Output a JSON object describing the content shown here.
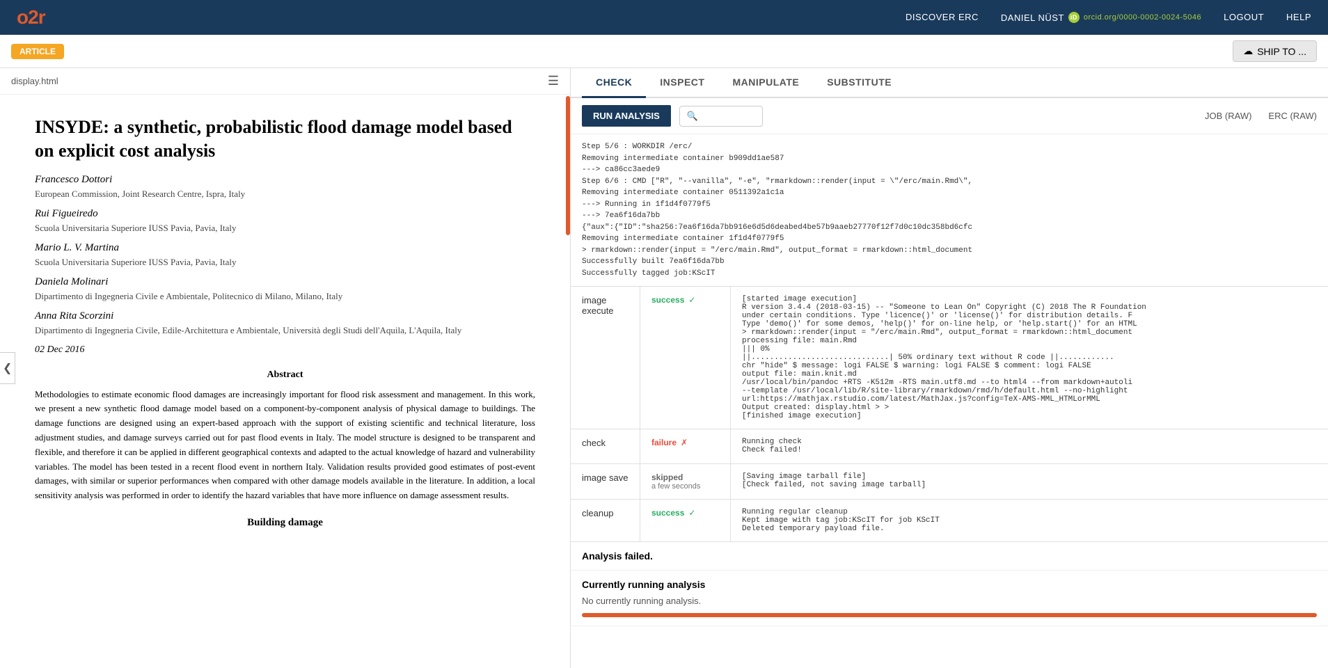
{
  "topnav": {
    "logo_text": "o2r",
    "discover_label": "DISCOVER ERC",
    "user_name": "DANIEL NÜST",
    "orcid_link": "orcid.org/0000-0002-0024-5046",
    "logout_label": "LOGOUT",
    "help_label": "HELP"
  },
  "article_bar": {
    "badge_label": "ARTICLE",
    "ship_to_label": "SHIP TO ..."
  },
  "left_panel": {
    "filename": "display.html",
    "article": {
      "title": "INSYDE: a synthetic, probabilistic flood damage model based on explicit cost analysis",
      "authors": [
        {
          "name": "Francesco Dottori",
          "affiliation": "European Commission, Joint Research Centre, Ispra, Italy"
        },
        {
          "name": "Rui Figueiredo",
          "affiliation": "Scuola Universitaria Superiore IUSS Pavia, Pavia, Italy"
        },
        {
          "name": "Mario L. V. Martina",
          "affiliation": "Scuola Universitaria Superiore IUSS Pavia, Pavia, Italy"
        },
        {
          "name": "Daniela Molinari",
          "affiliation": "Dipartimento di Ingegneria Civile e Ambientale, Politecnico di Milano, Milano, Italy"
        },
        {
          "name": "Anna Rita Scorzini",
          "affiliation": "Dipartimento di Ingegneria Civile, Edile-Architettura e Ambientale, Università degli Studi dell'Aquila, L'Aquila, Italy"
        }
      ],
      "date": "02 Dec 2016",
      "abstract_heading": "Abstract",
      "abstract_text": "Methodologies to estimate economic flood damages are increasingly important for flood risk assessment and management. In this work, we present a new synthetic flood damage model based on a component-by-component analysis of physical damage to buildings. The damage functions are designed using an expert-based approach with the support of existing scientific and technical literature, loss adjustment studies, and damage surveys carried out for past flood events in Italy. The model structure is designed to be transparent and flexible, and therefore it can be applied in different geographical contexts and adapted to the actual knowledge of hazard and vulnerability variables. The model has been tested in a recent flood event in northern Italy. Validation results provided good estimates of post-event damages, with similar or superior performances when compared with other damage models available in the literature. In addition, a local sensitivity analysis was performed in order to identify the hazard variables that have more influence on damage assessment results.",
      "section_heading": "Building damage"
    }
  },
  "right_panel": {
    "tabs": [
      "CHECK",
      "INSPECT",
      "MANIPULATE",
      "SUBSTITUTE"
    ],
    "active_tab": "CHECK",
    "toolbar": {
      "run_analysis_label": "RUN ANALYSIS",
      "search_placeholder": "🔍",
      "job_raw_label": "JOB (RAW)",
      "erc_raw_label": "ERC (RAW)"
    },
    "step_log": {
      "content": "Step 5/6 : WORKDIR /erc/\nRemoving intermediate container b909dd1ae587\n---> ca86cc3aede9\nStep 6/6 : CMD [\"R\", \"--vanilla\", \"-e\", \"rmarkdown::render(input = \\\"/erc/main.Rmd\\\",\nRemoving intermediate container 0511392a1c1a\n---> Running in 1f1d4f0779f5\n---> 7ea6f16da7bb\n{\"aux\":{\"ID\":\"sha256:7ea6f16da7bb916e6d5d6deabed4be57b9aaeb27770f12f7d0c10dc358bd6cfc\nRemoving intermediate container 1f1d4f0779f5\n> rmarkdown::render(input = \"/erc/main.Rmd\", output_format = rmarkdown::html_document\nSuccessfully built 7ea6f16da7bb\nSuccessfully tagged job:KScIT"
    },
    "results": [
      {
        "label": "image execute",
        "status": "success",
        "status_icon": "✓",
        "log": "[started image execution]\nR version 3.4.4 (2018-03-15) -- \"Someone to Lean On\" Copyright (C) 2018 The R Foundation\nunder certain conditions. Type 'licence()' or 'license()' for distribution details. F\nType 'demo()' for some demos, 'help()' for on-line help, or 'help.start()' for an HTML\n> rmarkdown::render(input = \"/erc/main.Rmd\", output_format = rmarkdown::html_document\nprocessing file: main.Rmd\n||| 0%\n||..............................| 50% ordinary text without R code ||............\nchr \"hide\" $ message: logi FALSE $ warning: logi FALSE $ comment: logi FALSE\noutput file: main.knit.md\n/usr/local/bin/pandoc +RTS -K512m -RTS main.utf8.md --to html4 --from markdown+autoli\n--template /usr/local/lib/R/site-library/rmarkdown/rmd/h/default.html --no-highlight\nurl:https://mathjax.rstudio.com/latest/MathJax.js?config=TeX-AMS-MML_HTMLorMML\nOutput created: display.html > >\n[finished image execution]"
      },
      {
        "label": "check",
        "status": "failure",
        "status_icon": "✗",
        "log": "Running check\nCheck failed!"
      },
      {
        "label": "image save",
        "status": "skipped",
        "status_sub": "a few seconds",
        "log": "[Saving image tarball file]\n[Check failed, not saving image tarball]"
      },
      {
        "label": "cleanup",
        "status": "success",
        "status_icon": "✓",
        "log": "Running regular cleanup\nKept image with tag job:KScIT for job KScIT\nDeleted temporary payload file."
      }
    ],
    "analysis_failed_msg": "Analysis failed.",
    "currently_running_title": "Currently running analysis",
    "no_running_msg": "No currently running analysis."
  }
}
